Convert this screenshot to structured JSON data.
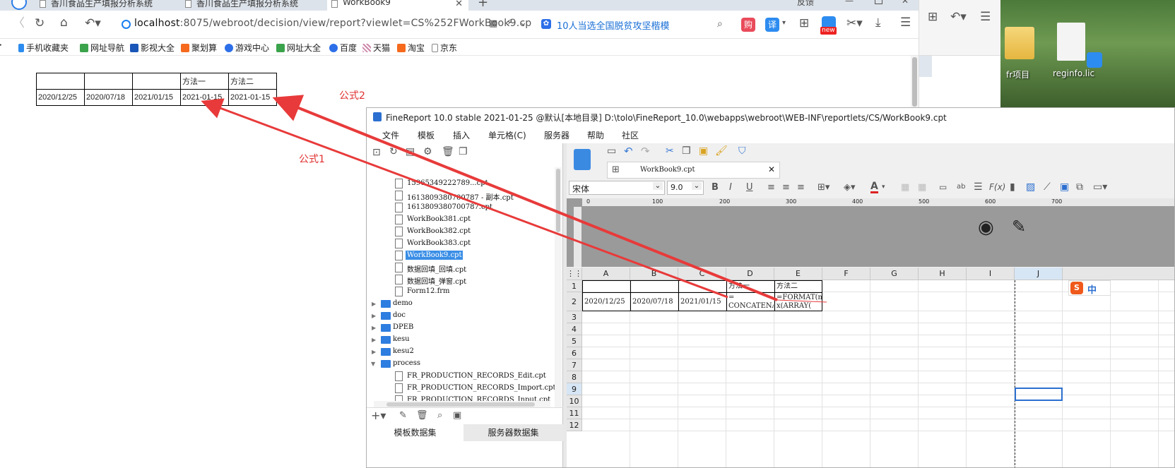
{
  "tabs": [
    {
      "label": "香川食品生产填报分析系统"
    },
    {
      "label": "香川食品生产填报分析系统"
    },
    {
      "label": "WorkBook9"
    }
  ],
  "tab_extra": "反馈",
  "address": {
    "host": "localhost",
    "path": ":8075/webroot/decision/view/report?viewlet=CS%252FWorkBook9.cp"
  },
  "search": {
    "text": "10人当选全国脱贫攻坚楷模"
  },
  "toolbar_badges": {
    "buy": "购",
    "translate": "译",
    "new": "new"
  },
  "bookmarks": [
    {
      "label": "手机收藏夹"
    },
    {
      "label": "网址导航"
    },
    {
      "label": "影视大全"
    },
    {
      "label": "聚划算"
    },
    {
      "label": "游戏中心"
    },
    {
      "label": "网址大全"
    },
    {
      "label": "百度"
    },
    {
      "label": "天猫"
    },
    {
      "label": "淘宝"
    },
    {
      "label": "京东"
    }
  ],
  "report": {
    "header": [
      "",
      "",
      "",
      "方法一",
      "方法二"
    ],
    "row": [
      "2020/12/25",
      "2020/07/18",
      "2021/01/15",
      "2021-01-15",
      "2021-01-15"
    ]
  },
  "annotations": {
    "formula1": "公式1",
    "formula2": "公式2"
  },
  "desktop": {
    "icons": [
      {
        "label": "fr项目"
      },
      {
        "label": "reginfo.lic"
      }
    ]
  },
  "finereport": {
    "title": "FineReport 10.0 stable 2021-01-25 @默认[本地目录]    D:\\tolo\\FineReport_10.0\\webapps\\webroot\\WEB-INF\\reportlets/CS/WorkBook9.cpt",
    "menu": [
      "文件",
      "模板",
      "插入",
      "单元格(C)",
      "服务器",
      "帮助",
      "社区"
    ],
    "tree": {
      "files_top": [
        {
          "name": "15965349222789...cpt"
        },
        {
          "name": "1613809380700787 - 副本.cpt"
        },
        {
          "name": "1613809380700787.cpt"
        },
        {
          "name": "WorkBook381.cpt"
        },
        {
          "name": "WorkBook382.cpt"
        },
        {
          "name": "WorkBook383.cpt"
        },
        {
          "name": "WorkBook9.cpt"
        },
        {
          "name": "数据回填_回填.cpt"
        },
        {
          "name": "数据回填_弹窗.cpt"
        },
        {
          "name": "Form12.frm"
        }
      ],
      "folders": [
        {
          "name": "demo"
        },
        {
          "name": "doc"
        },
        {
          "name": "DPEB"
        },
        {
          "name": "kesu"
        },
        {
          "name": "kesu2"
        },
        {
          "name": "process"
        }
      ],
      "process_files": [
        {
          "name": "FR_PRODUCTION_RECORDS_Edit.cpt"
        },
        {
          "name": "FR_PRODUCTION_RECORDS_Import.cpt"
        },
        {
          "name": "FR_PRODUCTION_RECORDS_Input.cpt"
        }
      ]
    },
    "bottom_tabs": [
      "模板数据集",
      "服务器数据集"
    ],
    "doc_tab": "WorkBook9.cpt",
    "font_name": "宋体",
    "font_size": "9.0",
    "ruler_ticks": [
      "0",
      "100",
      "200",
      "300",
      "400",
      "500",
      "600",
      "700"
    ],
    "columns": [
      "A",
      "B",
      "C",
      "D",
      "E",
      "F",
      "G",
      "H",
      "I",
      "J"
    ],
    "rows": [
      "1",
      "2",
      "3",
      "4",
      "5",
      "6",
      "7",
      "8",
      "9",
      "10",
      "11",
      "12"
    ],
    "cells": {
      "D1": "方法一",
      "E1": "方法二",
      "A2": "2020/12/25",
      "B2": "2020/07/18",
      "C2": "2021/01/15",
      "D2": "=\nCONCATENAT",
      "E2": "=FORMAT(ma\nx(ARRAY("
    },
    "ime": "中"
  }
}
